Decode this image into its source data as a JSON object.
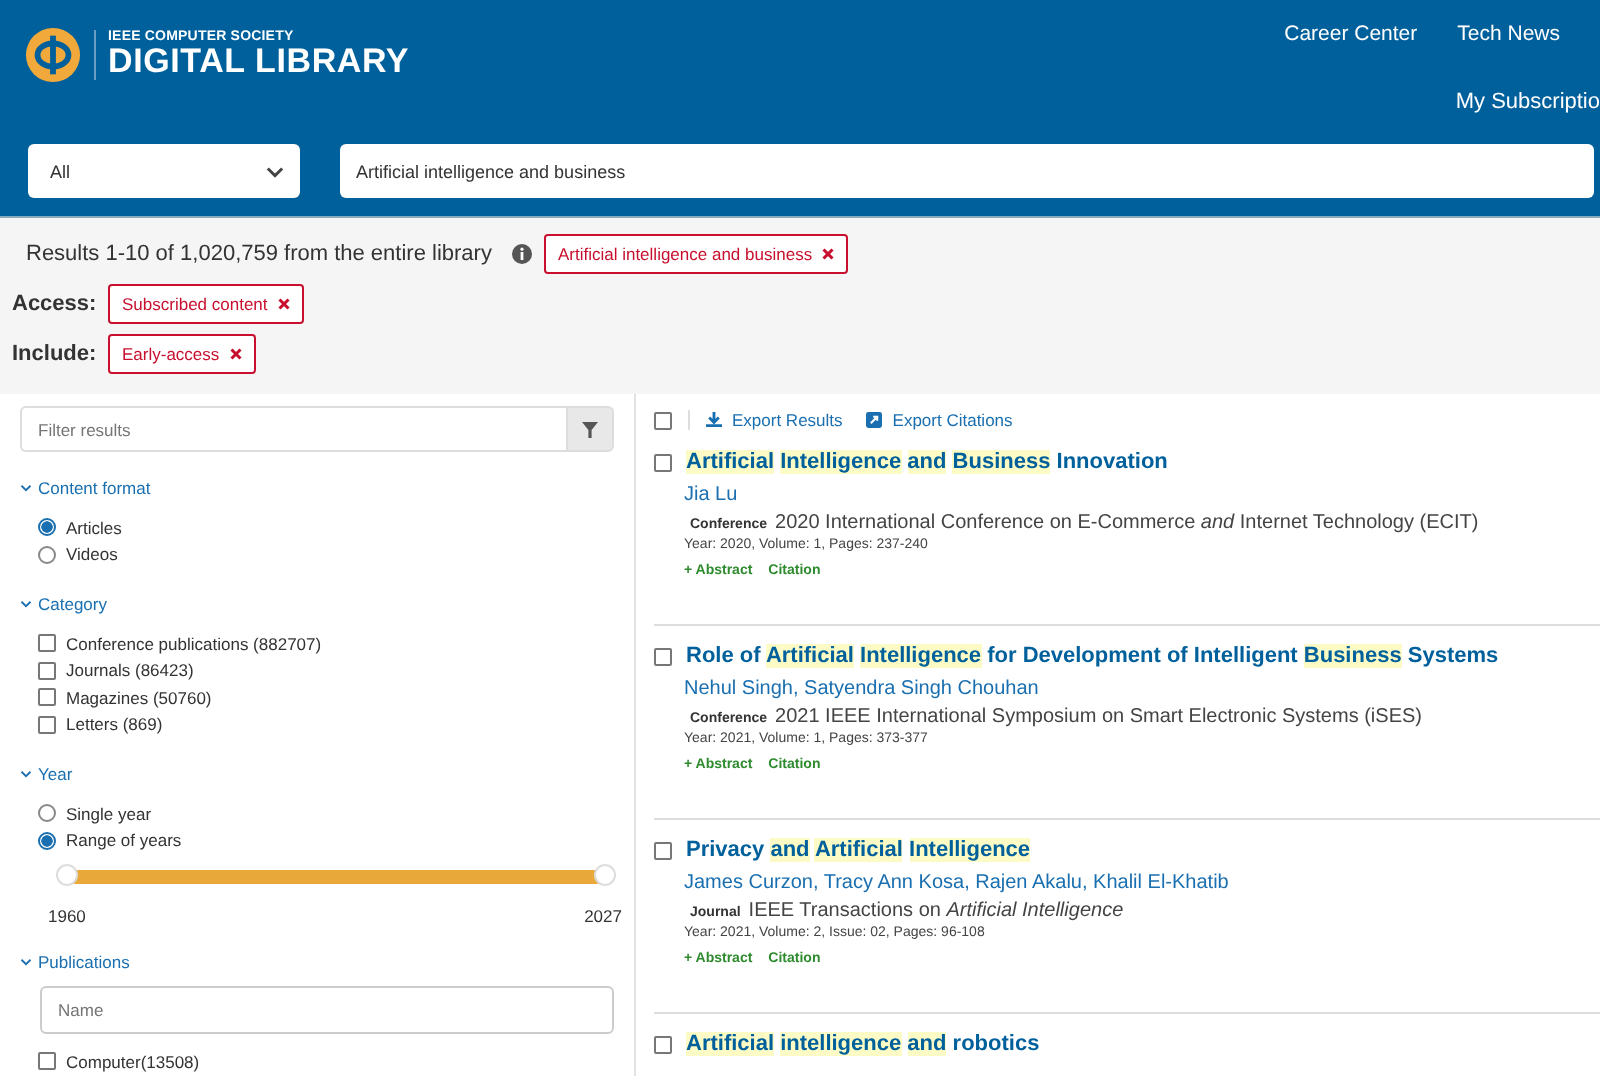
{
  "header": {
    "logo": {
      "subtitle": "IEEE COMPUTER SOCIETY",
      "title": "DIGITAL LIBRARY"
    },
    "nav_links": [
      "Career Center",
      "Tech News"
    ],
    "account_link": "My Subscriptio"
  },
  "search": {
    "scope": "All",
    "query": "Artificial intelligence and business"
  },
  "summary": {
    "text": "Results 1-10 of 1,020,759 from the entire library",
    "query_tag": "Artificial intelligence and business"
  },
  "filters_applied": [
    {
      "label": "Access:",
      "tag": "Subscribed content"
    },
    {
      "label": "Include:",
      "tag": "Early-access"
    }
  ],
  "sidebar": {
    "filter_placeholder": "Filter results",
    "sections": [
      {
        "title": "Content format",
        "kind": "radio",
        "expanded": true,
        "options": [
          {
            "label": "Articles",
            "selected": true
          },
          {
            "label": "Videos",
            "selected": false
          }
        ]
      },
      {
        "title": "Category",
        "kind": "checkbox",
        "expanded": true,
        "options": [
          {
            "label": "Conference publications (882707)",
            "checked": false
          },
          {
            "label": "Journals (86423)",
            "checked": false
          },
          {
            "label": "Magazines (50760)",
            "checked": false
          },
          {
            "label": "Letters (869)",
            "checked": false
          }
        ]
      },
      {
        "title": "Year",
        "kind": "radio",
        "expanded": true,
        "options": [
          {
            "label": "Single year",
            "selected": false
          },
          {
            "label": "Range of years",
            "selected": true
          }
        ],
        "range": {
          "level": 1,
          "min_label": "1960",
          "max_label": "2027"
        }
      },
      {
        "title": "Publications",
        "kind": "checkbox",
        "expanded": true,
        "placeholder": "Name",
        "options": [
          {
            "label": "Computer(13508)",
            "checked": false
          }
        ]
      }
    ]
  },
  "toolbar": {
    "select_all": false,
    "actions": [
      "Export Results",
      "Export Citations"
    ]
  },
  "results": [
    {
      "checked": false,
      "title": [
        {
          "text": "Artificial",
          "highlighted": true
        },
        {
          "text": "Intelligence",
          "highlighted": true
        },
        {
          "text": "and",
          "highlighted": true
        },
        {
          "text": "Business",
          "highlighted": true
        },
        {
          "text": "Innovation",
          "highlighted": false
        }
      ],
      "authors": "Jia Lu",
      "type": "Conference",
      "venue": "2020 International Conference on E-Commerce *and* Internet Technology (ECIT)",
      "details": "Year: 2020, Volume: 1, Pages: 237-240",
      "links": [
        "+ Abstract",
        "Citation"
      ]
    },
    {
      "checked": false,
      "title": [
        {
          "text": "Role of",
          "highlighted": false
        },
        {
          "text": "Artificial",
          "highlighted": true
        },
        {
          "text": "Intelligence",
          "highlighted": true
        },
        {
          "text": "for Development of Intelligent",
          "highlighted": false
        },
        {
          "text": "Business",
          "highlighted": true
        },
        {
          "text": "Systems",
          "highlighted": false
        }
      ],
      "authors": "Nehul Singh, Satyendra Singh Chouhan",
      "type": "Conference",
      "venue": "2021 IEEE International Symposium on Smart Electronic Systems (iSES)",
      "details": "Year: 2021, Volume: 1, Pages: 373-377",
      "links": [
        "+ Abstract",
        "Citation"
      ]
    },
    {
      "checked": false,
      "title": [
        {
          "text": "Privacy",
          "highlighted": false
        },
        {
          "text": "and",
          "highlighted": true
        },
        {
          "text": "Artificial",
          "highlighted": true
        },
        {
          "text": "Intelligence",
          "highlighted": true
        }
      ],
      "authors": "James Curzon, Tracy Ann Kosa, Rajen Akalu, Khalil El-Khatib",
      "type": "Journal",
      "venue": "IEEE Transactions on *Artificial Intelligence*",
      "details": "Year: 2021, Volume: 2, Issue: 02, Pages: 96-108",
      "links": [
        "+ Abstract",
        "Citation"
      ]
    },
    {
      "checked": false,
      "title": [
        {
          "text": "Artificial",
          "highlighted": true
        },
        {
          "text": "intelligence",
          "highlighted": true
        },
        {
          "text": "and",
          "highlighted": true
        },
        {
          "text": "robotics",
          "highlighted": false
        }
      ]
    }
  ]
}
